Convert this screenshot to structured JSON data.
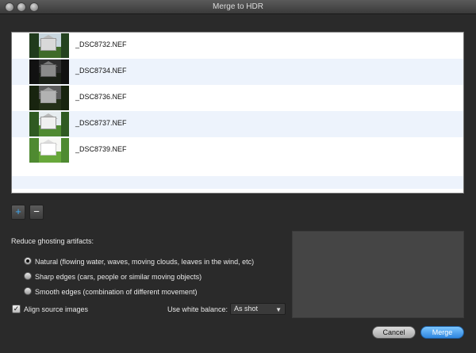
{
  "window": {
    "title": "Merge to HDR"
  },
  "files": [
    {
      "name": "_DSC8732.NEF"
    },
    {
      "name": "_DSC8734.NEF"
    },
    {
      "name": "_DSC8736.NEF"
    },
    {
      "name": "_DSC8737.NEF"
    },
    {
      "name": "_DSC8739.NEF"
    }
  ],
  "list_controls": {
    "add": "+",
    "remove": "−"
  },
  "ghosting": {
    "heading": "Reduce ghosting artifacts:",
    "options": [
      {
        "label": "Natural (flowing water, waves, moving clouds, leaves in the wind, etc)",
        "selected": true
      },
      {
        "label": "Sharp edges (cars, people or similar moving objects)",
        "selected": false
      },
      {
        "label": "Smooth edges (combination of different movement)",
        "selected": false
      }
    ]
  },
  "align": {
    "label": "Align source images",
    "checked": true,
    "mark": "✓"
  },
  "white_balance": {
    "label": "Use white balance:",
    "value": "As shot",
    "arrow": "▼"
  },
  "buttons": {
    "cancel": "Cancel",
    "merge": "Merge"
  },
  "colors": {
    "accent": "#3fa7f0",
    "primary_button": "#2f86df",
    "row_alt": "#edf3fc"
  }
}
